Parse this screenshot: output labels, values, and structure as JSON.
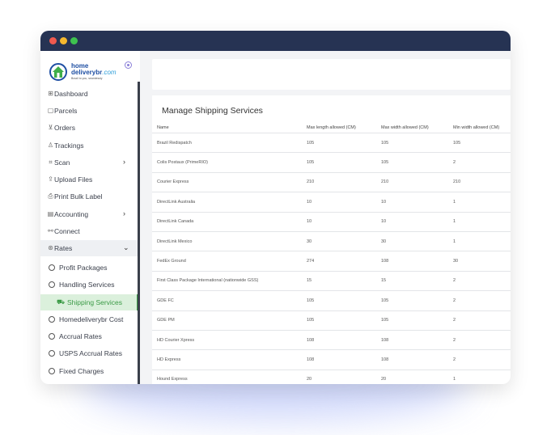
{
  "app": {
    "brand_line1": "home",
    "brand_line2": "deliverybr",
    "brand_suffix": ".com",
    "brand_tagline": "Brazil to you, seamlessly",
    "colors": {
      "titlebar": "#263353",
      "accent_active": "#3a9a45",
      "brand": "#1e4fa3"
    }
  },
  "sidebar": {
    "items": [
      {
        "label": "Dashboard",
        "icon": "dashboard-icon"
      },
      {
        "label": "Parcels",
        "icon": "box-icon"
      },
      {
        "label": "Orders",
        "icon": "cart-icon"
      },
      {
        "label": "Trackings",
        "icon": "tracking-icon"
      },
      {
        "label": "Scan",
        "icon": "scan-icon",
        "expandable": true
      },
      {
        "label": "Upload Files",
        "icon": "upload-icon"
      },
      {
        "label": "Print Bulk Label",
        "icon": "print-icon"
      },
      {
        "label": "Accounting",
        "icon": "accounting-icon",
        "expandable": true
      },
      {
        "label": "Connect",
        "icon": "link-icon"
      },
      {
        "label": "Rates",
        "icon": "rates-icon",
        "expanded": true
      }
    ],
    "rates_sub": [
      {
        "label": "Profit Packages"
      },
      {
        "label": "Handling Services"
      },
      {
        "label": "Shipping Services",
        "active": true
      },
      {
        "label": "Homedeliverybr Cost"
      },
      {
        "label": "Accrual Rates"
      },
      {
        "label": "USPS Accrual Rates"
      },
      {
        "label": "Fixed Charges"
      }
    ]
  },
  "main": {
    "title": "Manage Shipping Services",
    "columns": [
      "Name",
      "Max length allowed (CM)",
      "Max width allowed (CM)",
      "Min width allowed (CM)"
    ],
    "rows": [
      [
        "Brazil Redispatch",
        "105",
        "105",
        "105"
      ],
      [
        "Colis Postaux (PrimeRIO)",
        "105",
        "105",
        "2"
      ],
      [
        "Courier Express",
        "210",
        "210",
        "210"
      ],
      [
        "DirectLink Australia",
        "10",
        "10",
        "1"
      ],
      [
        "DirectLink Canada",
        "10",
        "10",
        "1"
      ],
      [
        "DirectLink Mexico",
        "30",
        "30",
        "1"
      ],
      [
        "FedEx Ground",
        "274",
        "108",
        "30"
      ],
      [
        "First Class Package International (nationwide GSS)",
        "15",
        "15",
        "2"
      ],
      [
        "GDE FC",
        "105",
        "105",
        "2"
      ],
      [
        "GDE PM",
        "105",
        "105",
        "2"
      ],
      [
        "HD Courier Xpress",
        "108",
        "108",
        "2"
      ],
      [
        "HD Express",
        "108",
        "108",
        "2"
      ],
      [
        "Hound Express",
        "20",
        "20",
        "1"
      ]
    ]
  }
}
